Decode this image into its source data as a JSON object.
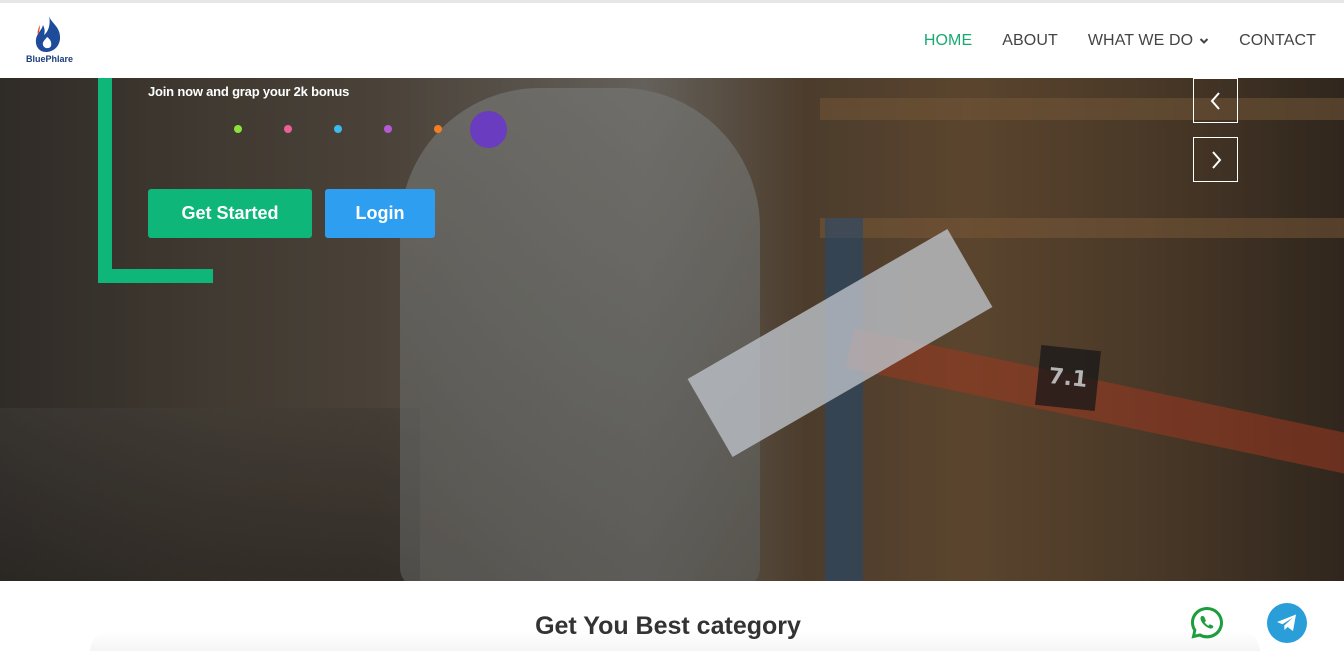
{
  "brand": {
    "name": "BluePhlare"
  },
  "nav": {
    "items": [
      {
        "label": "HOME",
        "active": true
      },
      {
        "label": "ABOUT",
        "active": false
      },
      {
        "label": "WHAT WE DO",
        "active": false,
        "dropdown": true
      },
      {
        "label": "CONTACT",
        "active": false
      }
    ]
  },
  "hero": {
    "subtitle": "Join now and grap your 2k bonus",
    "get_started_label": "Get Started",
    "login_label": "Login",
    "shelf_label": "7.1",
    "indicator_dots": [
      {
        "color": "#8be23a"
      },
      {
        "color": "#ec5f97"
      },
      {
        "color": "#3db9f2"
      },
      {
        "color": "#b55ad6"
      },
      {
        "color": "#f47d22"
      },
      {
        "color": "#6a3cc0",
        "active": true
      }
    ]
  },
  "section": {
    "title": "Get You Best category"
  },
  "colors": {
    "accent_green": "#0fb67a",
    "login_blue": "#2e9ff0",
    "nav_active": "#19a974",
    "whatsapp_green": "#1b9e3b",
    "telegram_blue": "#2a9ed9"
  },
  "icons": {
    "logo": "flame-logo-icon",
    "prev": "chevron-left-icon",
    "next": "chevron-right-icon",
    "dropdown": "chevron-down-icon",
    "whatsapp": "whatsapp-icon",
    "telegram": "telegram-icon"
  }
}
